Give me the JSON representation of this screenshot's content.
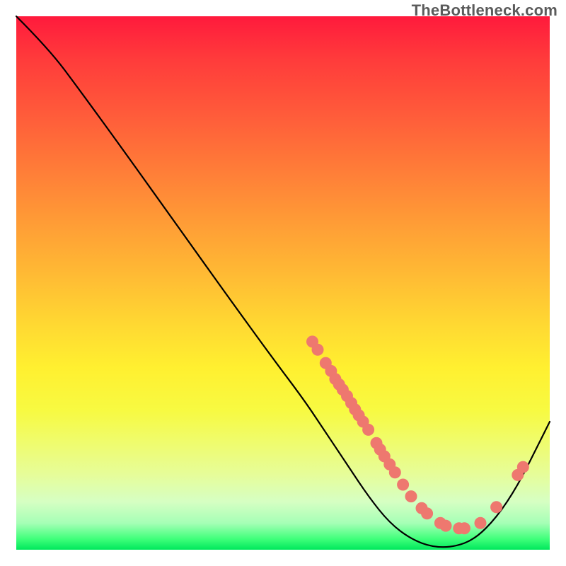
{
  "watermark": "TheBottleneck.com",
  "colors": {
    "curve_stroke": "#000000",
    "dot_fill": "#ee786f",
    "dot_stroke": "#ee786f"
  },
  "chart_data": {
    "type": "line",
    "title": "",
    "xlabel": "",
    "ylabel": "",
    "xlim": [
      0,
      100
    ],
    "ylim": [
      0,
      100
    ],
    "curve": [
      {
        "x": 0,
        "y": 100
      },
      {
        "x": 6,
        "y": 94
      },
      {
        "x": 12,
        "y": 86
      },
      {
        "x": 20,
        "y": 75
      },
      {
        "x": 30,
        "y": 61
      },
      {
        "x": 40,
        "y": 47
      },
      {
        "x": 48,
        "y": 36
      },
      {
        "x": 54,
        "y": 28
      },
      {
        "x": 58,
        "y": 22
      },
      {
        "x": 62,
        "y": 16
      },
      {
        "x": 66,
        "y": 10
      },
      {
        "x": 70,
        "y": 5
      },
      {
        "x": 74,
        "y": 2
      },
      {
        "x": 78,
        "y": 0.5
      },
      {
        "x": 82,
        "y": 0.5
      },
      {
        "x": 86,
        "y": 2
      },
      {
        "x": 90,
        "y": 6
      },
      {
        "x": 94,
        "y": 12
      },
      {
        "x": 98,
        "y": 20
      },
      {
        "x": 100,
        "y": 24
      }
    ],
    "dots": [
      {
        "x": 55.5,
        "y": 39.0
      },
      {
        "x": 56.5,
        "y": 37.5
      },
      {
        "x": 58.0,
        "y": 35.0
      },
      {
        "x": 59.0,
        "y": 33.5
      },
      {
        "x": 59.8,
        "y": 32.0
      },
      {
        "x": 60.5,
        "y": 31.0
      },
      {
        "x": 61.2,
        "y": 30.0
      },
      {
        "x": 62.0,
        "y": 28.8
      },
      {
        "x": 62.8,
        "y": 27.5
      },
      {
        "x": 63.5,
        "y": 26.3
      },
      {
        "x": 64.2,
        "y": 25.2
      },
      {
        "x": 65.0,
        "y": 24.0
      },
      {
        "x": 66.0,
        "y": 22.5
      },
      {
        "x": 67.5,
        "y": 20.0
      },
      {
        "x": 68.2,
        "y": 18.8
      },
      {
        "x": 69.0,
        "y": 17.5
      },
      {
        "x": 70.0,
        "y": 16.0
      },
      {
        "x": 71.0,
        "y": 14.5
      },
      {
        "x": 72.5,
        "y": 12.2
      },
      {
        "x": 74.0,
        "y": 10.0
      },
      {
        "x": 76.0,
        "y": 7.8
      },
      {
        "x": 77.0,
        "y": 6.8
      },
      {
        "x": 79.5,
        "y": 5.0
      },
      {
        "x": 80.5,
        "y": 4.5
      },
      {
        "x": 83.0,
        "y": 4.0
      },
      {
        "x": 84.0,
        "y": 4.0
      },
      {
        "x": 87.0,
        "y": 5.0
      },
      {
        "x": 90.0,
        "y": 8.0
      },
      {
        "x": 94.0,
        "y": 14.0
      },
      {
        "x": 95.0,
        "y": 15.5
      }
    ],
    "dot_radius_px": 8
  }
}
